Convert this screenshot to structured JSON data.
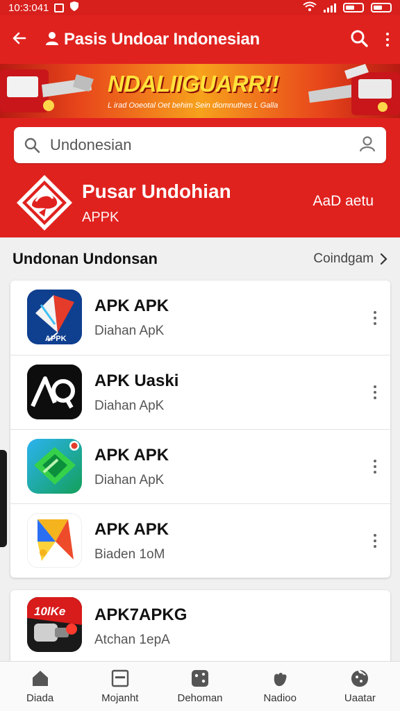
{
  "status_bar": {
    "time": "10:3:041"
  },
  "app_bar": {
    "title": "Pasis Undoar Indonesian",
    "back_icon": "arrow-left-icon",
    "search_icon": "search-icon",
    "more_icon": "more-vert-icon"
  },
  "banner": {
    "headline": "NDALIIGUARR!!",
    "tagline": "L irad Ooeotal Oet behim Sein diomnuthes L Galla"
  },
  "search": {
    "value": "Undonesian"
  },
  "brand": {
    "name": "Pusar Undohian",
    "subtitle": "APPK",
    "action_label": "AaD aetu"
  },
  "section": {
    "title": "Undonan Undonsan",
    "link_label": "Coindgam"
  },
  "apps": [
    {
      "name": "APK APK",
      "subtitle": "Diahan ApK",
      "icon_label": "APPK",
      "icon": "kite-app-icon"
    },
    {
      "name": "APK Uaski",
      "subtitle": "Diahan ApK",
      "icon": "aq-app-icon"
    },
    {
      "name": "APK APK",
      "subtitle": "Diahan ApK",
      "icon": "green-diamond-app-icon"
    },
    {
      "name": "APK APK",
      "subtitle": "Biaden 1oM",
      "icon": "play-triangle-app-icon"
    },
    {
      "name": "APK7APKG",
      "subtitle": "Atchan 1epA",
      "icon_label": "10lKe",
      "icon": "red-gadget-app-icon"
    }
  ],
  "bottom_nav": [
    {
      "label": "Diada",
      "icon": "home-icon"
    },
    {
      "label": "Mojanht",
      "icon": "card-icon"
    },
    {
      "label": "Dehoman",
      "icon": "dice-icon"
    },
    {
      "label": "Nadioo",
      "icon": "hand-icon"
    },
    {
      "label": "Uaatar",
      "icon": "cookie-icon"
    }
  ]
}
